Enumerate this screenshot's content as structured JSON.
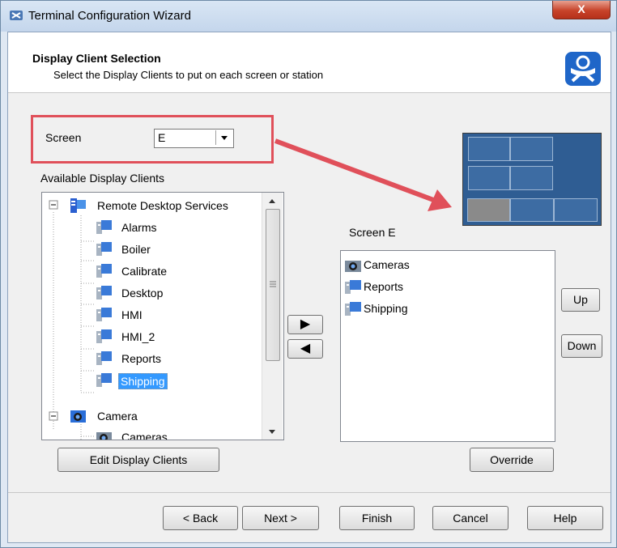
{
  "window": {
    "title": "Terminal Configuration Wizard",
    "close_glyph": "X"
  },
  "header": {
    "title": "Display Client Selection",
    "subtitle": "Select the Display Clients to put on each screen or station",
    "logo_icon": "thinmanager-logo-icon"
  },
  "screen_select": {
    "label": "Screen",
    "value": "E"
  },
  "available": {
    "label": "Available Display Clients",
    "tree": [
      {
        "label": "Remote Desktop Services",
        "icon": "rds-icon"
      },
      {
        "label": "Alarms",
        "icon": "display-client-icon"
      },
      {
        "label": "Boiler",
        "icon": "display-client-icon"
      },
      {
        "label": "Calibrate",
        "icon": "display-client-icon"
      },
      {
        "label": "Desktop",
        "icon": "display-client-icon"
      },
      {
        "label": "HMI",
        "icon": "display-client-icon"
      },
      {
        "label": "HMI_2",
        "icon": "display-client-icon"
      },
      {
        "label": "Reports",
        "icon": "display-client-icon"
      },
      {
        "label": "Shipping",
        "icon": "display-client-icon",
        "selected": true
      },
      {
        "label": "Camera",
        "icon": "camera-icon"
      },
      {
        "label": "Cameras",
        "icon": "camera-icon"
      }
    ]
  },
  "screen_list": {
    "label": "Screen E",
    "items": [
      {
        "label": "Cameras",
        "icon": "camera-icon"
      },
      {
        "label": "Reports",
        "icon": "display-client-icon"
      },
      {
        "label": "Shipping",
        "icon": "display-client-icon"
      }
    ]
  },
  "buttons": {
    "add_glyph": "▶",
    "remove_glyph": "◀",
    "up": "Up",
    "down": "Down",
    "edit": "Edit Display Clients",
    "override": "Override",
    "back": "< Back",
    "next": "Next >",
    "finish": "Finish",
    "cancel": "Cancel",
    "help": "Help"
  },
  "colors": {
    "highlight": "#e0505a",
    "arrow": "#e0505a",
    "selection": "#3399ff",
    "preview_cell": "#3d6ca3",
    "preview_selected": "#8a8a8a"
  }
}
